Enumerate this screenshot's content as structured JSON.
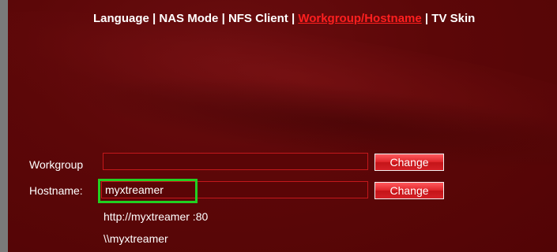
{
  "nav": {
    "items": [
      {
        "label": "Language"
      },
      {
        "label": "NAS Mode"
      },
      {
        "label": "NFS Client"
      },
      {
        "label": "Workgroup/Hostname"
      },
      {
        "label": "TV Skin"
      }
    ],
    "separator": "|",
    "active_color": "#ff1f1f"
  },
  "form": {
    "workgroup": {
      "label": "Workgroup",
      "value": "",
      "button": "Change"
    },
    "hostname": {
      "label": "Hostname:",
      "value": "myxtreamer",
      "button": "Change"
    },
    "http_address": "http://myxtreamer :80",
    "smb_path": "\\\\myxtreamer"
  },
  "colors": {
    "panel_bg": "#5c0708",
    "field_border": "#c4181b",
    "highlight": "#22d022"
  }
}
